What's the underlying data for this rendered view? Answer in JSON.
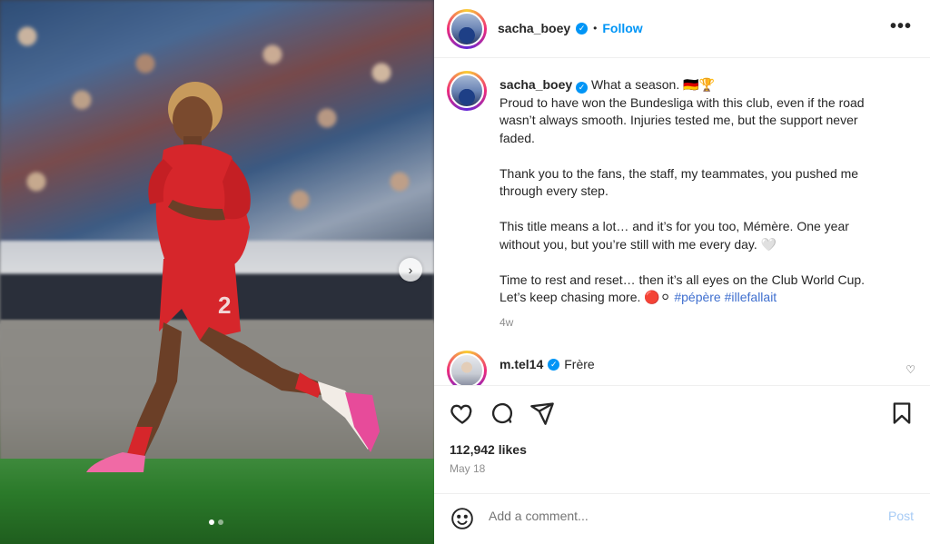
{
  "media": {
    "next_icon": "chevron-right-icon",
    "carousel_dots": 2,
    "active_dot": 0
  },
  "header": {
    "username": "sacha_boey",
    "separator": "•",
    "follow_label": "Follow",
    "more_icon": "more-horizontal-icon",
    "more_label": "•••"
  },
  "caption": {
    "username": "sacha_boey",
    "headline": "What a season. 🇩🇪🏆",
    "paragraphs": [
      "Proud to have won the Bundesliga with this club, even if the road wasn’t always smooth. Injuries tested me, but the support never faded.",
      "Thank you to the fans, the staff, my teammates, you pushed me through every step.",
      "This title means a lot… and it’s for you too, Mémère. One year without you, but you’re still with me every day. 🤍",
      "Time to rest and reset… then it’s all eyes on the Club World Cup. Let’s keep chasing more. 🔴⚪"
    ],
    "hashtags": "#pépère #illefallait",
    "time_ago": "4w"
  },
  "comment": {
    "username": "m.tel14",
    "text": "Frère"
  },
  "actions": {
    "likes": "112,942 likes",
    "date": "May 18"
  },
  "add_comment": {
    "placeholder": "Add a comment...",
    "post_label": "Post"
  },
  "colors": {
    "link_blue": "#0095f6",
    "hashtag_blue": "#3f6fcf",
    "text": "#262626",
    "muted": "#8e8e8e"
  }
}
